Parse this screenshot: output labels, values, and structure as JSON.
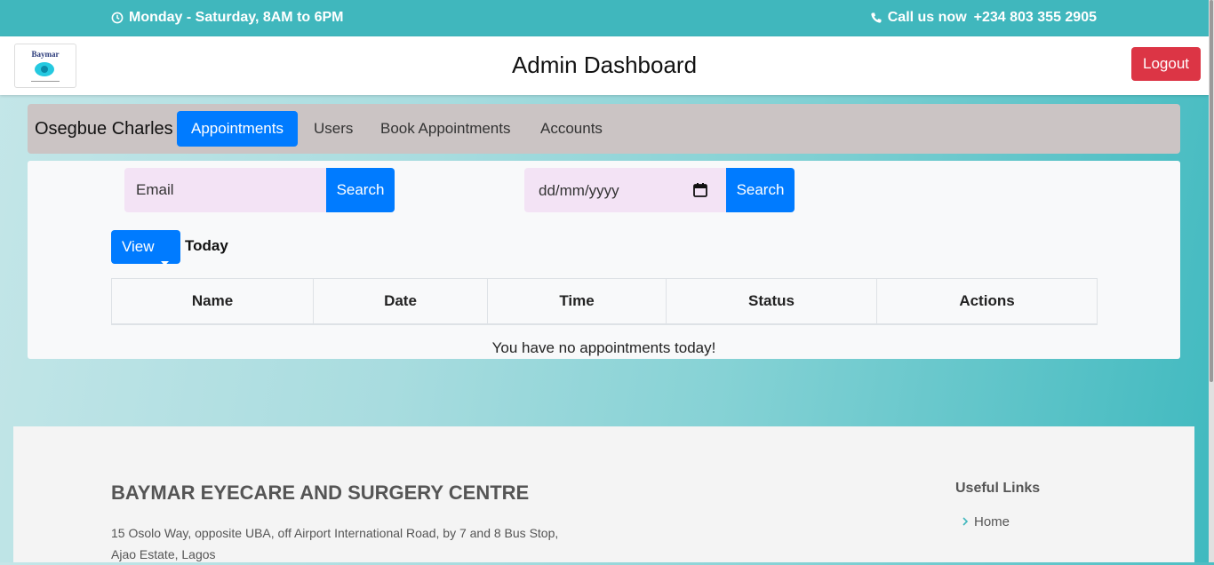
{
  "topbar": {
    "hours": "Monday - Saturday, 8AM to 6PM",
    "call_label": "Call us now",
    "phone": "+234 803 355 2905"
  },
  "header": {
    "logo_text": "Baymar",
    "title": "Admin Dashboard",
    "logout_label": "Logout"
  },
  "nav": {
    "user_name": "Osegbue Charles",
    "tabs": [
      {
        "label": "Appointments",
        "active": true
      },
      {
        "label": "Users",
        "active": false
      },
      {
        "label": "Book Appointments",
        "active": false
      },
      {
        "label": "Accounts",
        "active": false
      }
    ]
  },
  "filters": {
    "email_placeholder": "Email",
    "email_search_label": "Search",
    "date_placeholder": "dd/mm/yyyy",
    "date_search_label": "Search"
  },
  "view": {
    "button_label": "View",
    "current": "Today"
  },
  "table": {
    "columns": [
      "Name",
      "Date",
      "Time",
      "Status",
      "Actions"
    ],
    "empty_message": "You have no appointments today!"
  },
  "footer": {
    "org_name": "BAYMAR EYECARE AND SURGERY CENTRE",
    "address": "15 Osolo Way, opposite UBA, off Airport International Road, by 7 and 8 Bus Stop, Ajao Estate, Lagos",
    "links_title": "Useful Links",
    "links": [
      "Home"
    ]
  },
  "colors": {
    "topbar": "#40b7bd",
    "primary": "#007bff",
    "danger": "#dc3545",
    "nav_bg": "#cbc4c4",
    "input_bg": "#f3e3f5"
  }
}
